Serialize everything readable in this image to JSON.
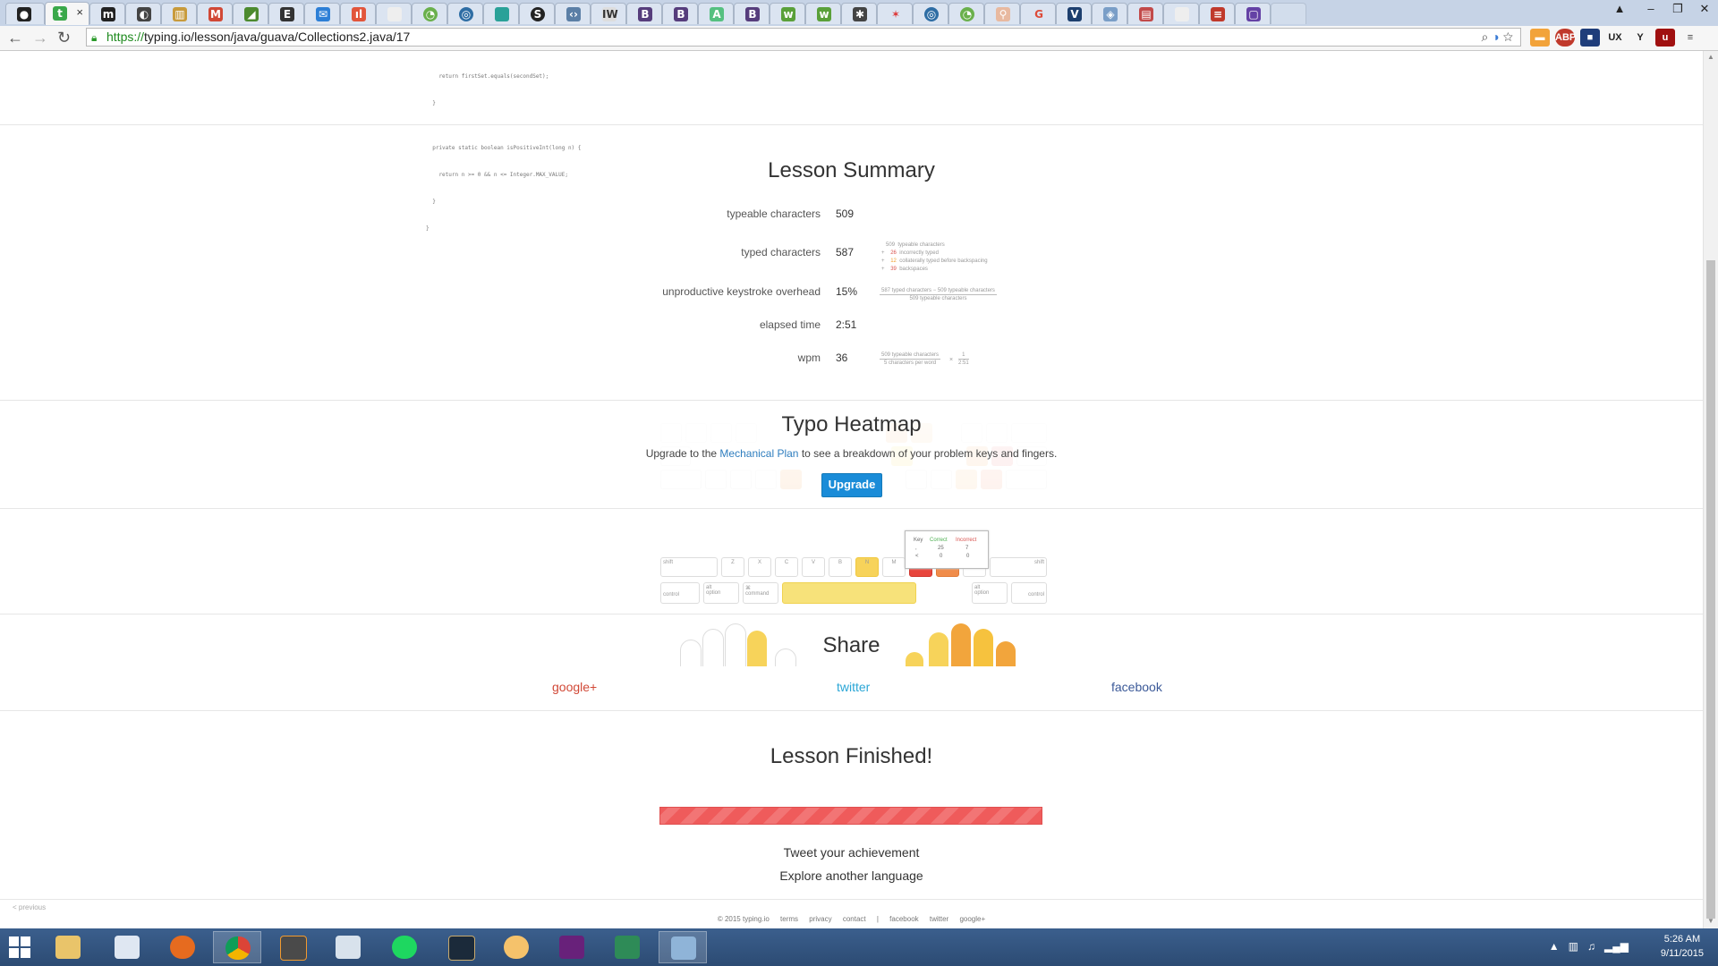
{
  "browser": {
    "url_scheme": "https://",
    "url_rest": "typing.io/lesson/java/guava/Collections2.java/17",
    "tab_count": 33
  },
  "code": {
    "lines": [
      "    return firstSet.equals(secondSet);",
      "  }",
      "",
      "  private static boolean isPositiveInt(long n) {",
      "    return n >= 0 && n <= Integer.MAX_VALUE;",
      "  }",
      "}"
    ]
  },
  "summary": {
    "title": "Lesson Summary",
    "rows": [
      {
        "label": "typeable characters",
        "value": "509"
      },
      {
        "label": "typed characters",
        "value": "587"
      },
      {
        "label": "unproductive keystroke overhead",
        "value": "15%"
      },
      {
        "label": "elapsed time",
        "value": "2:51"
      },
      {
        "label": "wpm",
        "value": "36"
      }
    ],
    "typed_breakdown": [
      {
        "sign": "",
        "num": "509",
        "text": "typeable characters"
      },
      {
        "sign": "+",
        "num": "26",
        "text": "incorrectly typed"
      },
      {
        "sign": "+",
        "num": "12",
        "text": "collaterally typed before backspacing"
      },
      {
        "sign": "+",
        "num": "39",
        "text": "backspaces"
      }
    ],
    "overhead_num": "587 typed characters − 509 typeable characters",
    "overhead_den": "509 typeable characters",
    "wpm_num": "509 typeable characters",
    "wpm_den": "5 characters per word",
    "wpm_times": "×",
    "wpm_num2": "1",
    "wpm_den2": "2:51"
  },
  "heatmap": {
    "title": "Typo Heatmap",
    "msg_pre": "Upgrade to the ",
    "msg_link": "Mechanical Plan",
    "msg_post": " to see a breakdown of your problem keys and fingers.",
    "button": "Upgrade",
    "keys_row_bottom": [
      "shift",
      "Z",
      "X",
      "C",
      "V",
      "B",
      "N",
      "M",
      "",
      "",
      "/",
      "shift"
    ],
    "keys_row_space": [
      "control",
      "alt\noption",
      "⌘\ncommand",
      "",
      "alt\noption",
      "control"
    ],
    "tooltip": {
      "h_key": "Key",
      "h_correct": "Correct",
      "h_incorrect": "Incorrect",
      "rows": [
        {
          "key": ",",
          "correct": "25",
          "incorrect": "7"
        },
        {
          "key": "<",
          "correct": "0",
          "incorrect": "0"
        }
      ]
    }
  },
  "share": {
    "title": "Share",
    "google": "google+",
    "twitter": "twitter",
    "facebook": "facebook"
  },
  "finish": {
    "title": "Lesson Finished!",
    "progress": 1.0,
    "tweet": "Tweet your achievement",
    "explore": "Explore another language"
  },
  "footer": {
    "prev": "< previous",
    "copyright": "© 2015 typing.io",
    "terms": "terms",
    "privacy": "privacy",
    "contact": "contact",
    "sep": "|",
    "facebook": "facebook",
    "twitter": "twitter",
    "google": "google+"
  },
  "taskbar": {
    "time": "5:26 AM",
    "date": "9/11/2015"
  },
  "colors": {
    "accent": "#1a8cd8",
    "link": "#2e7dbe",
    "google": "#d14836",
    "twitter": "#2aa6d6",
    "facebook": "#3b5998",
    "progress": "#ef5b5b"
  }
}
